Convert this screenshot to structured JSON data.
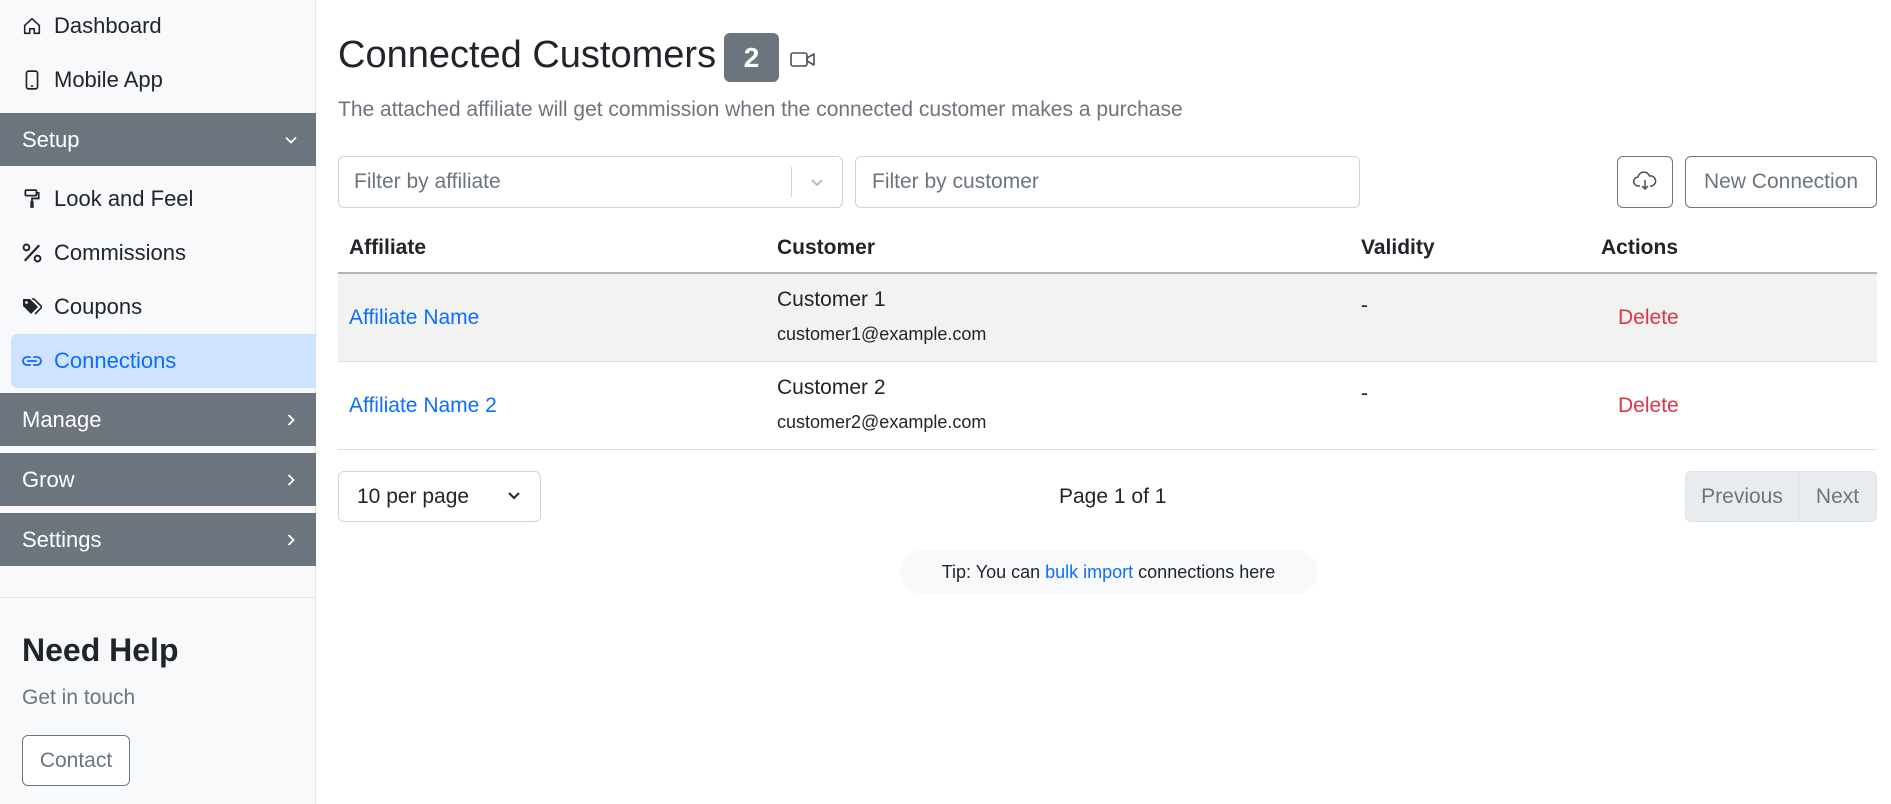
{
  "sidebar": {
    "top_items": [
      {
        "label": "Dashboard",
        "icon": "home-icon"
      },
      {
        "label": "Mobile App",
        "icon": "phone-icon"
      }
    ],
    "setup": {
      "label": "Setup",
      "items": [
        {
          "label": "Look and Feel",
          "icon": "paint-roller-icon"
        },
        {
          "label": "Commissions",
          "icon": "percent-icon"
        },
        {
          "label": "Coupons",
          "icon": "tags-icon"
        },
        {
          "label": "Connections",
          "icon": "link-icon",
          "active": true
        }
      ]
    },
    "sections": [
      {
        "label": "Manage"
      },
      {
        "label": "Grow"
      },
      {
        "label": "Settings"
      }
    ],
    "help": {
      "title": "Need Help",
      "subtitle": "Get in touch",
      "contact_label": "Contact"
    }
  },
  "header": {
    "title": "Connected Customers",
    "count": "2",
    "subtitle": "The attached affiliate will get commission when the connected customer makes a purchase"
  },
  "filters": {
    "affiliate_placeholder": "Filter by affiliate",
    "customer_placeholder": "Filter by customer"
  },
  "actions": {
    "new_connection_label": "New Connection"
  },
  "table": {
    "columns": [
      "Affiliate",
      "Customer",
      "Validity",
      "Actions"
    ],
    "rows": [
      {
        "affiliate": "Affiliate Name",
        "customer_name": "Customer 1",
        "customer_email": "customer1@example.com",
        "validity": "-",
        "action": "Delete"
      },
      {
        "affiliate": "Affiliate Name 2",
        "customer_name": "Customer 2",
        "customer_email": "customer2@example.com",
        "validity": "-",
        "action": "Delete"
      }
    ]
  },
  "pagination": {
    "per_page": "10 per page",
    "page_info": "Page 1 of 1",
    "previous_label": "Previous",
    "next_label": "Next"
  },
  "tip": {
    "prefix": "Tip: You can",
    "link": "bulk import",
    "suffix": "connections here"
  },
  "colors": {
    "accent": "#0d6efd",
    "section_bg": "#6c757d",
    "active_bg": "#cfe2ff",
    "danger": "#dc3545"
  }
}
